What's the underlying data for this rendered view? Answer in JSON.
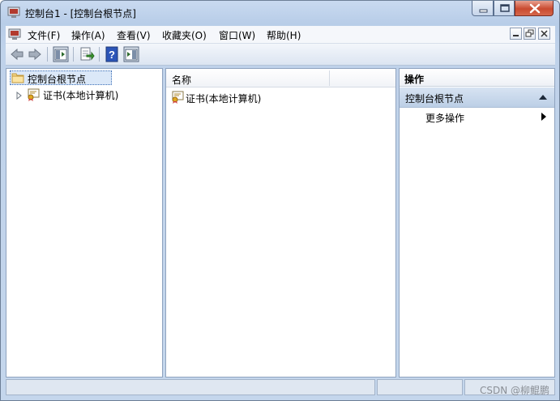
{
  "window": {
    "title": "控制台1 - [控制台根节点]"
  },
  "menubar": {
    "items": [
      {
        "label": "文件(F)"
      },
      {
        "label": "操作(A)"
      },
      {
        "label": "查看(V)"
      },
      {
        "label": "收藏夹(O)"
      },
      {
        "label": "窗口(W)"
      },
      {
        "label": "帮助(H)"
      }
    ]
  },
  "tree": {
    "root_label": "控制台根节点",
    "children": [
      {
        "label": "证书(本地计算机)"
      }
    ]
  },
  "list": {
    "column_name": "名称",
    "rows": [
      {
        "name": "证书(本地计算机)"
      }
    ]
  },
  "actions": {
    "header": "操作",
    "section_title": "控制台根节点",
    "items": [
      {
        "label": "更多操作"
      }
    ]
  },
  "watermark": "CSDN @柳鲲鹏",
  "colors": {
    "title_bar": "#c9daf0",
    "close_button": "#c94a30",
    "selection": "#dbe8f8",
    "action_section": "#bccfe6"
  }
}
